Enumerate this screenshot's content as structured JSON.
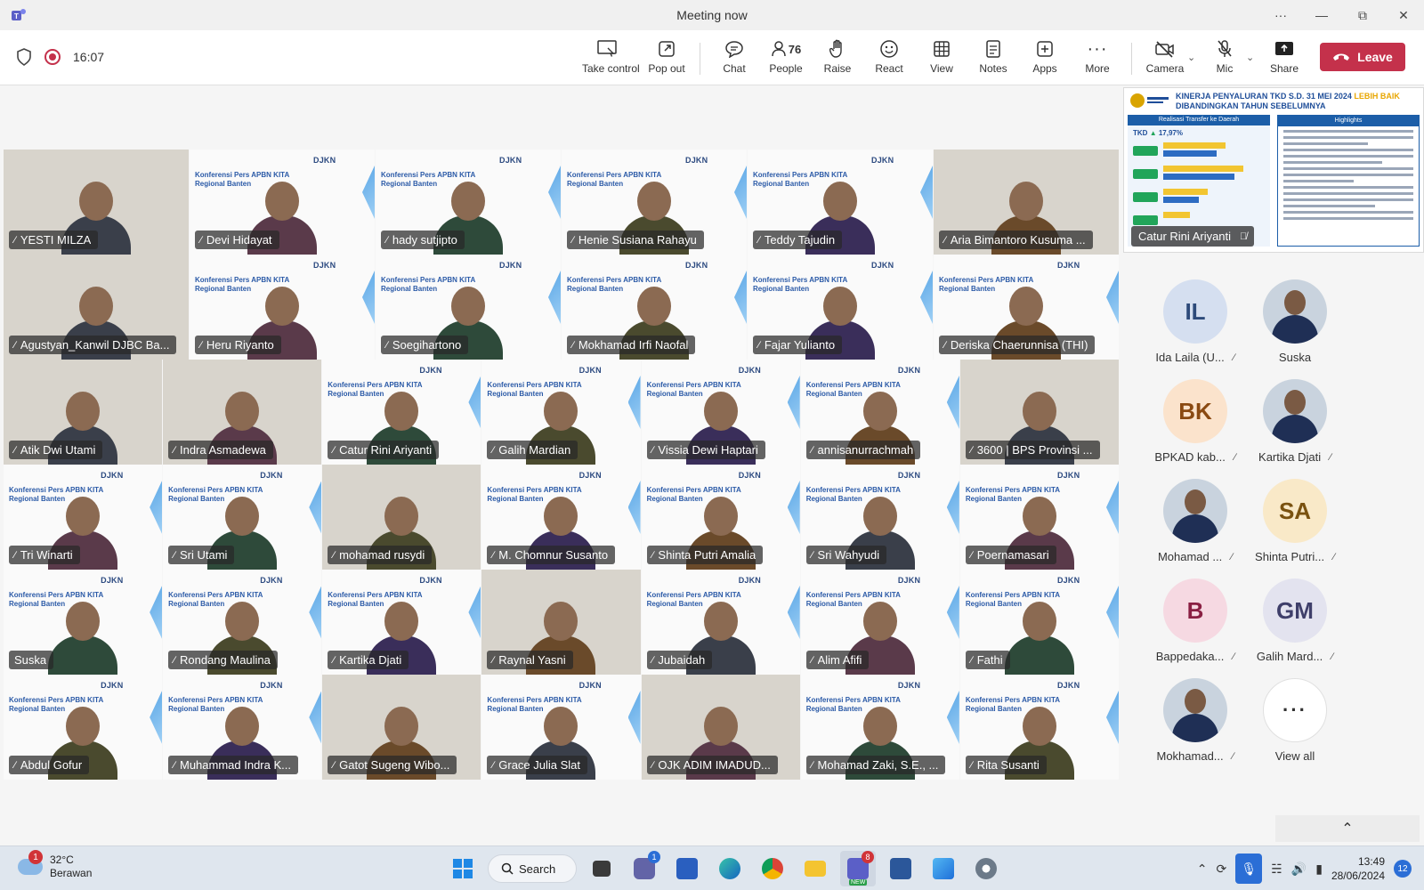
{
  "window": {
    "title": "Meeting now",
    "more_label": "···",
    "controls": [
      "—",
      "⧉",
      "✕"
    ]
  },
  "toolbar": {
    "timer": "16:07",
    "buttons": {
      "take_control": "Take control",
      "pop_out": "Pop out",
      "chat": "Chat",
      "people": "People",
      "people_count": "76",
      "raise": "Raise",
      "react": "React",
      "view": "View",
      "notes": "Notes",
      "apps": "Apps",
      "more": "More",
      "camera": "Camera",
      "mic": "Mic",
      "share": "Share"
    },
    "leave_label": "Leave",
    "leave_color": "#c4314b"
  },
  "slide": {
    "header": "DJKN",
    "title_lines": [
      "Konferensi Pers APBN KITA",
      "Regional Banten"
    ]
  },
  "participants": [
    {
      "name": "YESTI MILZA",
      "kind": "room"
    },
    {
      "name": "Devi Hidayat",
      "kind": "slide"
    },
    {
      "name": "hady sutjipto",
      "kind": "slide"
    },
    {
      "name": "Henie Susiana Rahayu",
      "kind": "slide"
    },
    {
      "name": "Teddy Tajudin",
      "kind": "slide"
    },
    {
      "name": "Aria Bimantoro Kusuma ...",
      "kind": "room"
    },
    {
      "name": "Agustyan_Kanwil DJBC Ba...",
      "kind": "room"
    },
    {
      "name": "Heru Riyanto",
      "kind": "slide"
    },
    {
      "name": "Soegihartono",
      "kind": "slide"
    },
    {
      "name": "Mokhamad Irfi Naofal",
      "kind": "slide"
    },
    {
      "name": "Fajar Yulianto",
      "kind": "slide"
    },
    {
      "name": "Deriska Chaerunnisa (THI)",
      "kind": "slide"
    },
    {
      "name": "Atik Dwi Utami",
      "kind": "room"
    },
    {
      "name": "Indra Asmadewa",
      "kind": "room"
    },
    {
      "name": "Catur Rini Ariyanti",
      "kind": "slide"
    },
    {
      "name": "Galih Mardian",
      "kind": "slide"
    },
    {
      "name": "Vissia Dewi Haptari",
      "kind": "slide"
    },
    {
      "name": "annisanurrachmah",
      "kind": "slide"
    },
    {
      "name": "3600 | BPS Provinsi ...",
      "kind": "room"
    },
    {
      "name": "Tri Winarti",
      "kind": "slide"
    },
    {
      "name": "Sri Utami",
      "kind": "slide"
    },
    {
      "name": "mohamad rusydi",
      "kind": "room"
    },
    {
      "name": "M. Chomnur Susanto",
      "kind": "slide"
    },
    {
      "name": "Shinta Putri Amalia",
      "kind": "slide"
    },
    {
      "name": "Sri Wahyudi",
      "kind": "slide"
    },
    {
      "name": "Poernamasari",
      "kind": "slide"
    },
    {
      "name": "Suska",
      "kind": "slide",
      "no_mic": true
    },
    {
      "name": "Rondang Maulina",
      "kind": "slide"
    },
    {
      "name": "Kartika Djati",
      "kind": "slide"
    },
    {
      "name": "Raynal Yasni",
      "kind": "room"
    },
    {
      "name": "Jubaidah",
      "kind": "slide"
    },
    {
      "name": "Alim Afifi",
      "kind": "slide"
    },
    {
      "name": "Fathi",
      "kind": "slide"
    },
    {
      "name": "Abdul Gofur",
      "kind": "slide"
    },
    {
      "name": "Muhammad Indra K...",
      "kind": "slide"
    },
    {
      "name": "Gatot Sugeng Wibo...",
      "kind": "room"
    },
    {
      "name": "Grace Julia Slat",
      "kind": "slide"
    },
    {
      "name": "OJK ADIM IMADUD...",
      "kind": "room"
    },
    {
      "name": "Mohamad Zaki, S.E., ...",
      "kind": "slide"
    },
    {
      "name": "Rita Susanti",
      "kind": "slide"
    }
  ],
  "shared_screen": {
    "title_line1": "KINERJA PENYALURAN TKD S.D. 31 MEI 2024",
    "title_highlight": "LEBIH BAIK",
    "title_line2": "DIBANDINGKAN TAHUN SEBELUMNYA",
    "left_header": "Realisasi Transfer ke Daerah",
    "right_header": "Highlights",
    "tkd_label": "TKD",
    "tkd_value": "17,97%",
    "presenter": "Catur Rini Ariyanti"
  },
  "side_gallery": [
    {
      "initials": "IL",
      "label": "Ida Laila (U...",
      "bg": "#d5dff0",
      "fg": "#2d4a7a",
      "muted": true
    },
    {
      "initials": "",
      "label": "Suska",
      "photo": true,
      "muted": false
    },
    {
      "initials": "BK",
      "label": "BPKAD kab...",
      "bg": "#fbe3cc",
      "fg": "#8a4a12",
      "muted": true
    },
    {
      "initials": "",
      "label": "Kartika Djati",
      "photo": true,
      "muted": true
    },
    {
      "initials": "",
      "label": "Mohamad ...",
      "photo": true,
      "muted": true
    },
    {
      "initials": "SA",
      "label": "Shinta Putri...",
      "bg": "#f9e9c8",
      "fg": "#7a5210",
      "muted": true
    },
    {
      "initials": "B",
      "label": "Bappedaka...",
      "bg": "#f6d9e2",
      "fg": "#8a2043",
      "muted": true
    },
    {
      "initials": "GM",
      "label": "Galih Mard...",
      "bg": "#e3e3ef",
      "fg": "#3f3f6a",
      "muted": true
    },
    {
      "initials": "",
      "label": "Mokhamad...",
      "photo": true,
      "muted": true
    }
  ],
  "view_all_label": "View all",
  "taskbar": {
    "weather_temp": "32°C",
    "weather_desc": "Berawan",
    "weather_badge": "1",
    "search_label": "Search",
    "chat_badge": "1",
    "teams_badge": "8",
    "teams_new": "NEW",
    "time": "13:49",
    "date": "28/06/2024",
    "notifications": "12"
  }
}
